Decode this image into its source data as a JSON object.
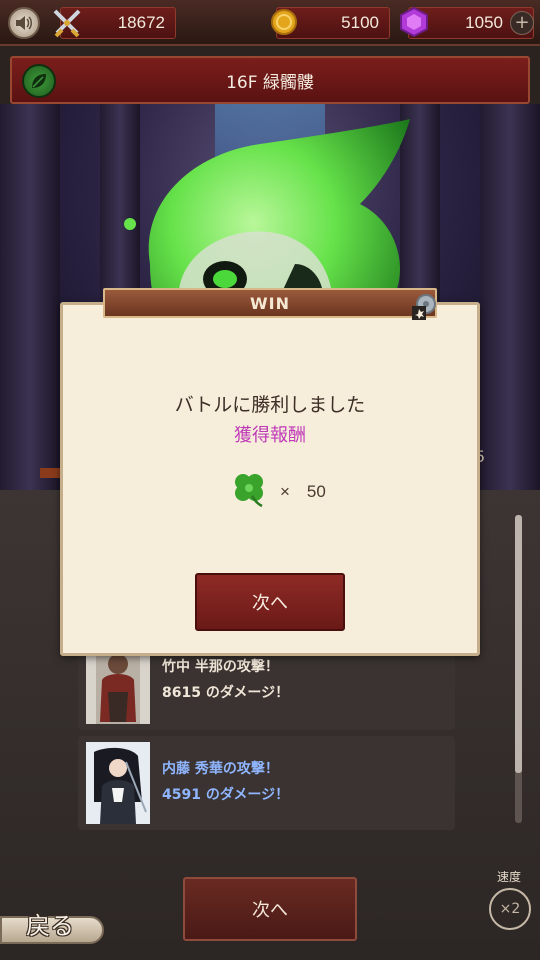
{
  "resources": {
    "power": "18672",
    "coins": "5100",
    "gems": "1050",
    "plus_label": "+"
  },
  "floor": {
    "title": "16F  緑髑髏"
  },
  "hp_number": "5",
  "battle_log": [
    {
      "line1": "竹中 半那の攻撃！",
      "line2": "8615 のダメージ！",
      "color": "#f0e6d8"
    },
    {
      "line1": "内藤 秀華の攻撃！",
      "line2": "4591 のダメージ！",
      "color": "#8fb6ff"
    }
  ],
  "dialog": {
    "banner": "WIN",
    "message": "バトルに勝利しました",
    "reward_title": "獲得報酬",
    "reward_icon": "clover-icon",
    "reward_qty": "×　50",
    "next_label": "次へ"
  },
  "footer": {
    "next_label": "次へ",
    "back_label": "戻る",
    "speed_label": "速度",
    "speed_value": "×2"
  },
  "colors": {
    "accent_red": "#7b1e1c",
    "reward_pink": "#c03ab8",
    "monster_green": "#66e24a"
  }
}
